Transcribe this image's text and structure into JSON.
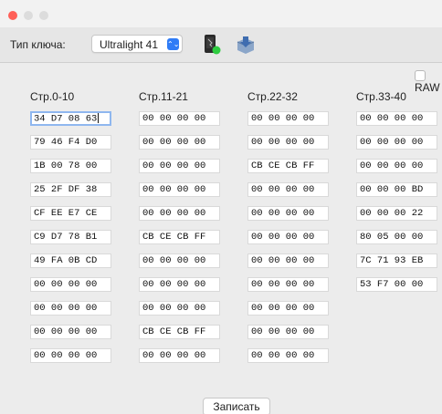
{
  "toolbar": {
    "key_type_label": "Тип ключа:",
    "key_type_value": "Ultralight 41",
    "key_type_arrow": "⌃⌄"
  },
  "raw_label": "RAW",
  "columns": [
    {
      "header": "Стр.0-10",
      "cells": [
        "34 D7 08 63",
        "79 46 F4 D0",
        "1B 00 78 00",
        "25 2F DF 38",
        "CF EE E7 CE",
        "C9 D7 78 B1",
        "49 FA 0B CD",
        "00 00 00 00",
        "00 00 00 00",
        "00 00 00 00",
        "00 00 00 00"
      ]
    },
    {
      "header": "Стр.11-21",
      "cells": [
        "00 00 00 00",
        "00 00 00 00",
        "00 00 00 00",
        "00 00 00 00",
        "00 00 00 00",
        "CB CE CB FF",
        "00 00 00 00",
        "00 00 00 00",
        "00 00 00 00",
        "CB CE CB FF",
        "00 00 00 00"
      ]
    },
    {
      "header": "Стр.22-32",
      "cells": [
        "00 00 00 00",
        "00 00 00 00",
        "CB CE CB FF",
        "00 00 00 00",
        "00 00 00 00",
        "00 00 00 00",
        "00 00 00 00",
        "00 00 00 00",
        "00 00 00 00",
        "00 00 00 00",
        "00 00 00 00"
      ]
    },
    {
      "header": "Стр.33-40",
      "cells": [
        "00 00 00 00",
        "00 00 00 00",
        "00 00 00 00",
        "00 00 00 BD",
        "00 00 00 22",
        "80 05 00 00",
        "7C 71 93 EB",
        "53 F7 00 00"
      ]
    }
  ],
  "write_button_label": "Записать"
}
